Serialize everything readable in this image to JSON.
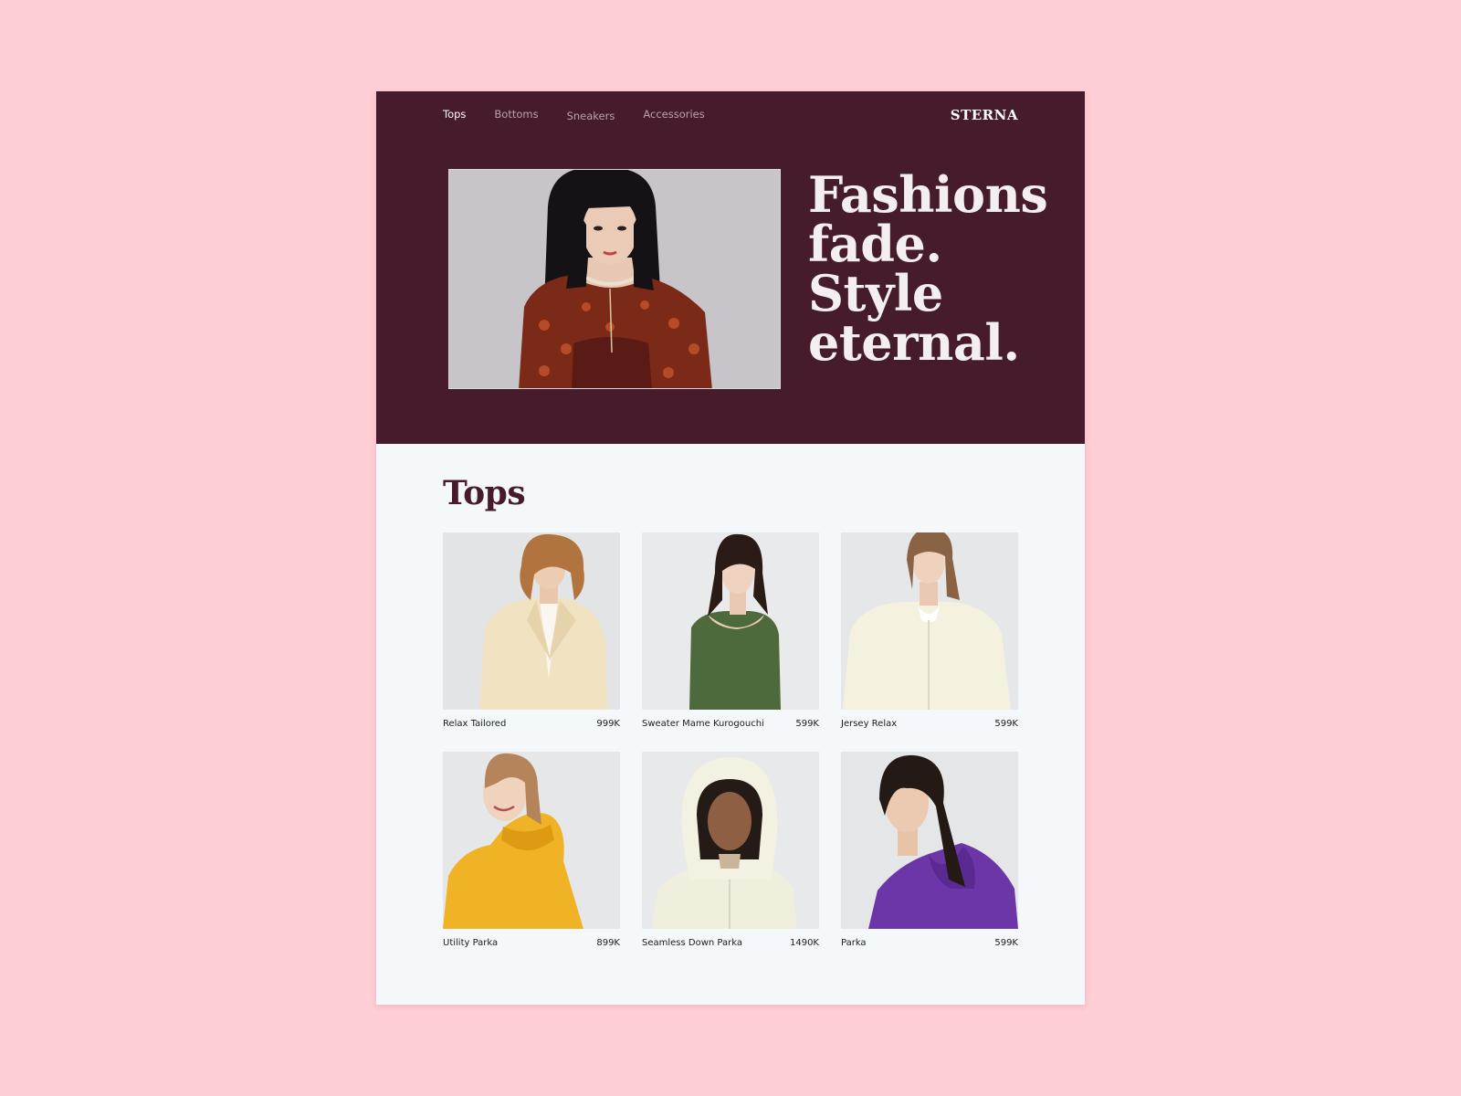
{
  "nav": {
    "items": [
      {
        "label": "Tops",
        "active": true
      },
      {
        "label": "Bottoms",
        "active": false
      },
      {
        "label": "Sneakers",
        "active": false
      },
      {
        "label": "Accessories",
        "active": false
      }
    ]
  },
  "brand": "STERNA",
  "hero": {
    "headline_lines": [
      "Fashions",
      "fade.",
      "Style",
      "eternal."
    ]
  },
  "section": {
    "title": "Tops"
  },
  "products": [
    {
      "name": "Relax Tailored",
      "price": "999K",
      "garment_color": "#f1e2c1"
    },
    {
      "name": "Sweater Mame Kurogouchi",
      "price": "599K",
      "garment_color": "#4d6a3c"
    },
    {
      "name": "Jersey Relax",
      "price": "599K",
      "garment_color": "#f4f1df"
    },
    {
      "name": "Utility Parka",
      "price": "899K",
      "garment_color": "#f0b325"
    },
    {
      "name": "Seamless Down Parka",
      "price": "1490K",
      "garment_color": "#f0eedd"
    },
    {
      "name": "Parka",
      "price": "599K",
      "garment_color": "#6c36a8"
    }
  ],
  "colors": {
    "page_background": "#ffcdd4",
    "hero_background": "#461b2c",
    "content_background": "#f4f8fa",
    "section_title": "#461b2c"
  }
}
